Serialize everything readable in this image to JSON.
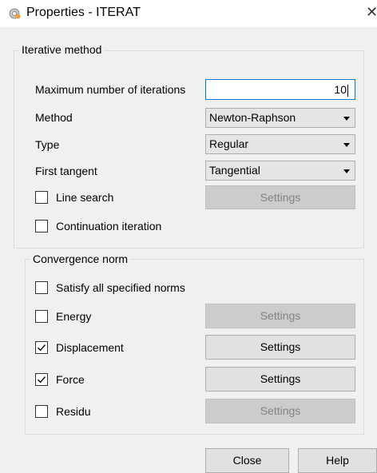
{
  "window": {
    "title": "Properties - ITERAT",
    "close_glyph": "✕"
  },
  "iterative": {
    "group_label": "Iterative method",
    "max_iter": {
      "label": "Maximum number of iterations",
      "value": "10"
    },
    "method": {
      "label": "Method",
      "value": "Newton-Raphson"
    },
    "type": {
      "label": "Type",
      "value": "Regular"
    },
    "first_tangent": {
      "label": "First tangent",
      "value": "Tangential"
    },
    "line_search": {
      "label": "Line search",
      "checked": false,
      "button": "Settings",
      "button_enabled": false
    },
    "continuation": {
      "label": "Continuation iteration",
      "checked": false
    }
  },
  "convergence": {
    "group_label": "Convergence norm",
    "satisfy_all": {
      "label": "Satisfy all specified norms",
      "checked": false
    },
    "energy": {
      "label": "Energy",
      "checked": false,
      "button": "Settings",
      "button_enabled": false
    },
    "displacement": {
      "label": "Displacement",
      "checked": true,
      "button": "Settings",
      "button_enabled": true
    },
    "force": {
      "label": "Force",
      "checked": true,
      "button": "Settings",
      "button_enabled": true
    },
    "residu": {
      "label": "Residu",
      "checked": false,
      "button": "Settings",
      "button_enabled": false
    }
  },
  "footer": {
    "close_label": "Close",
    "help_label": "Help"
  },
  "icons": {
    "app": "gear-icon",
    "close": "close-icon",
    "combo_arrow": "chevron-down-icon",
    "check": "checkmark-icon"
  },
  "colors": {
    "focus_border": "#0078d7",
    "dialog_bg": "#f0f0f0",
    "disabled_text": "#838383"
  }
}
